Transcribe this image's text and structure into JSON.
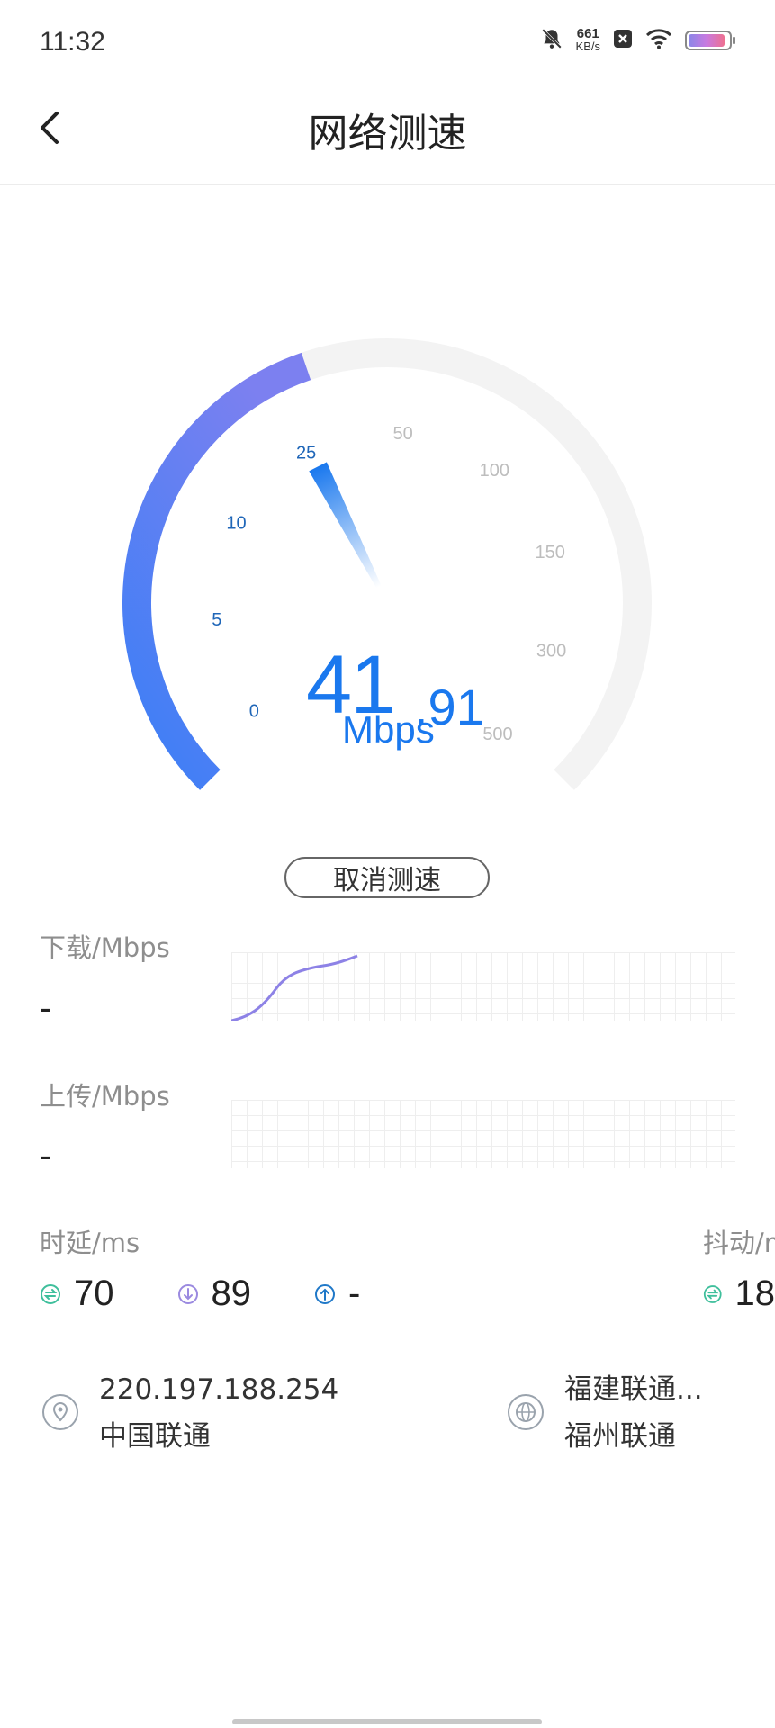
{
  "status_bar": {
    "time": "11:32",
    "net_speed_value": "661",
    "net_speed_unit": "KB/s"
  },
  "header": {
    "title": "网络测速"
  },
  "gauge": {
    "ticks": [
      "0",
      "5",
      "10",
      "25",
      "50",
      "100",
      "150",
      "300",
      "500"
    ],
    "progress_fraction": 0.43,
    "speed_integer": "41",
    "speed_decimal": ".91",
    "unit": "Mbps",
    "colors": {
      "active": "#3c82f6",
      "active_end": "#7b7ff0",
      "track": "#f3f3f3",
      "tick_active": "#1f66b8",
      "tick_inactive": "#bdbdbd"
    }
  },
  "cancel_button": {
    "label": "取消测速"
  },
  "download": {
    "label": "下载/Mbps",
    "value": "-"
  },
  "upload": {
    "label": "上传/Mbps",
    "value": "-"
  },
  "latency": {
    "label": "时延/ms",
    "idle": "70",
    "down": "89",
    "up": "-"
  },
  "jitter": {
    "label": "抖动/m",
    "value": "18"
  },
  "ip_info": {
    "ip": "220.197.188.254",
    "isp": "中国联通"
  },
  "server_info": {
    "name": "福建联通...",
    "city": "福州联通"
  }
}
